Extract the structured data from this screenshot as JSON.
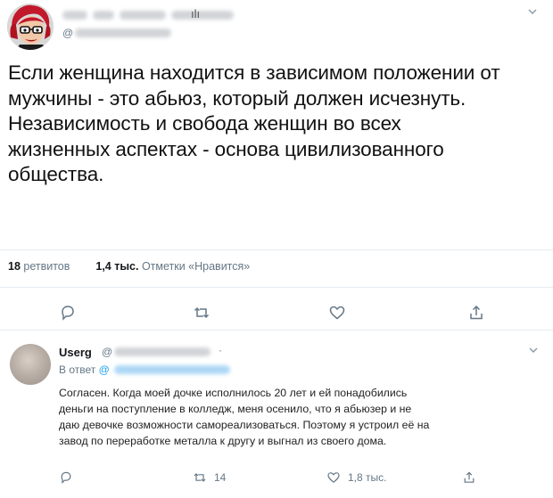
{
  "main_tweet": {
    "handle_prefix": "@",
    "text_lines": [
      "Если женщина находится в зависимом положении от",
      "мужчины - это абьюз, который должен исчезнуть.",
      "Независимость и свобода женщин во всех",
      "жизненных аспектах - основа цивилизованного",
      "общества."
    ],
    "retweets_count": "18",
    "retweets_label": "ретвитов",
    "likes_count": "1,4 тыс.",
    "likes_label": "Отметки «Нравится»"
  },
  "reply_tweet": {
    "author_name": "Userg",
    "handle_prefix": "@",
    "dot": "·",
    "reply_to_prefix": "В ответ",
    "reply_to_handle": "@",
    "text_lines": [
      "Согласен. Когда моей дочке исполнилось 20 лет и ей понадобились",
      "деньги на поступление в колледж, меня осенило, что я абьюзер и не",
      "даю девочке возможности самореализоваться. Поэтому я устроил её на",
      "завод по переработке металла к другу и выгнал из своего дома."
    ],
    "retweet_count": "14",
    "like_count": "1,8 тыс."
  },
  "icons": {
    "avatar_main": "cartoon-avatar-red-hair-glasses",
    "reply": "reply-icon",
    "retweet": "retweet-icon",
    "like": "heart-icon",
    "share": "share-icon",
    "more": "chevron-down-icon"
  },
  "colors": {
    "text": "#14171a",
    "muted": "#657786",
    "link": "#1da1f2",
    "divider": "#e6ecf0"
  }
}
